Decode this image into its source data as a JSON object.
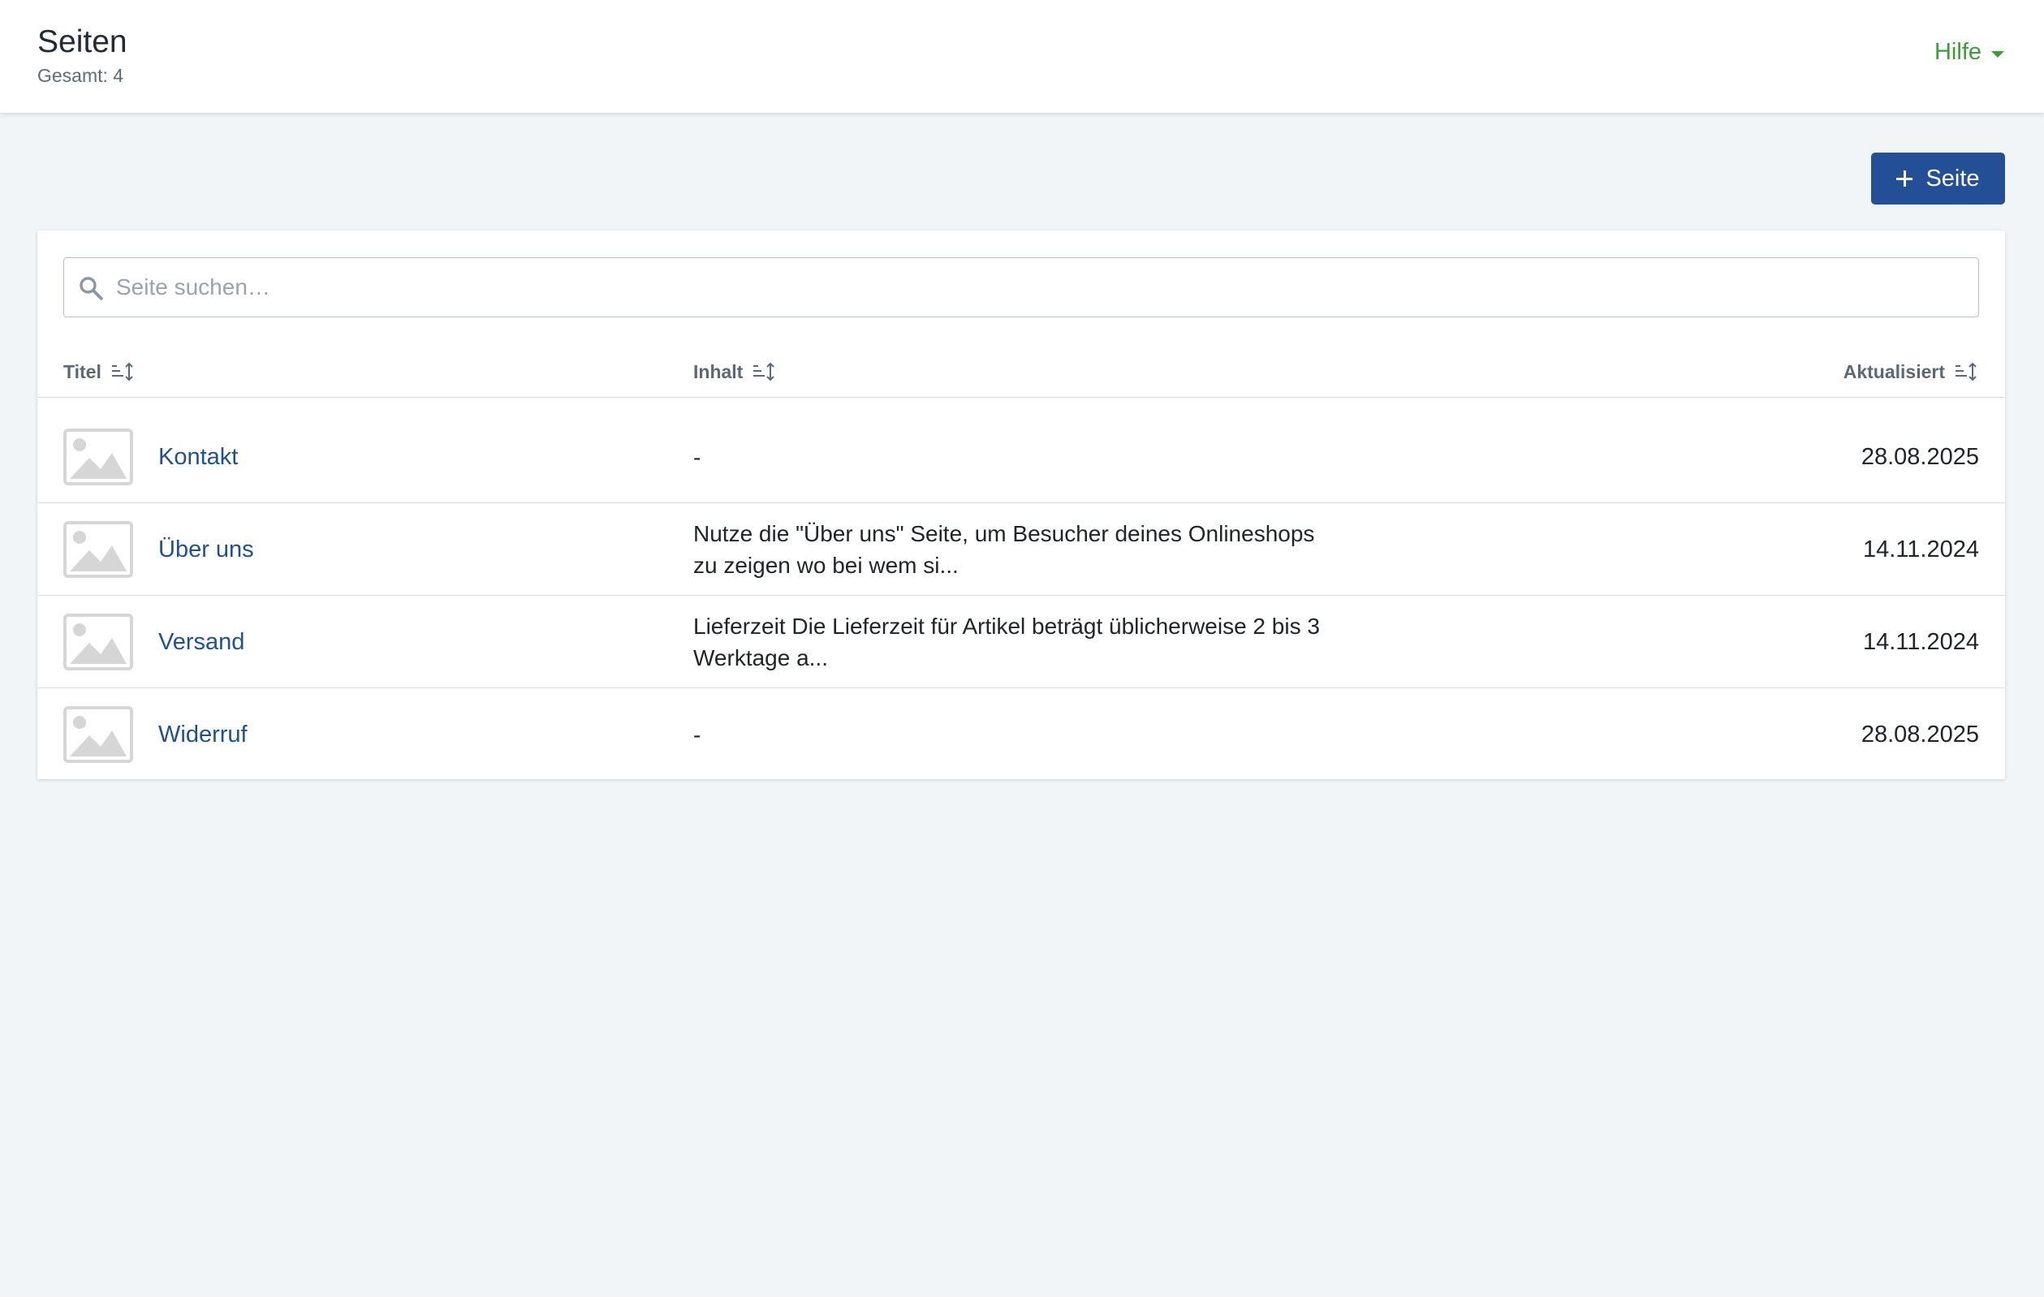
{
  "header": {
    "title": "Seiten",
    "subtitle": "Gesamt: 4",
    "help_label": "Hilfe"
  },
  "toolbar": {
    "add_label": "Seite"
  },
  "search": {
    "placeholder": "Seite suchen…"
  },
  "table": {
    "columns": {
      "title": "Titel",
      "content": "Inhalt",
      "updated": "Aktualisiert"
    },
    "rows": [
      {
        "title": "Kontakt",
        "content": "-",
        "updated": "28.08.2025"
      },
      {
        "title": "Über uns",
        "content": "Nutze die \"Über uns\" Seite, um Besucher deines Onlineshops zu zeigen wo bei wem si...",
        "updated": "14.11.2024"
      },
      {
        "title": "Versand",
        "content": "Lieferzeit Die Lieferzeit für Artikel beträgt üblicherweise 2 bis 3 Werktage a...",
        "updated": "14.11.2024"
      },
      {
        "title": "Widerruf",
        "content": "-",
        "updated": "28.08.2025"
      }
    ]
  },
  "colors": {
    "accent": "#234f96",
    "link": "#21508f",
    "help": "#3f9a3a",
    "background": "#f2f5f8"
  },
  "icons": {
    "search": "search-icon",
    "sort": "sort-icon",
    "thumbnail": "image-placeholder-icon",
    "add": "plus-icon",
    "dropdown": "chevron-down-icon"
  }
}
